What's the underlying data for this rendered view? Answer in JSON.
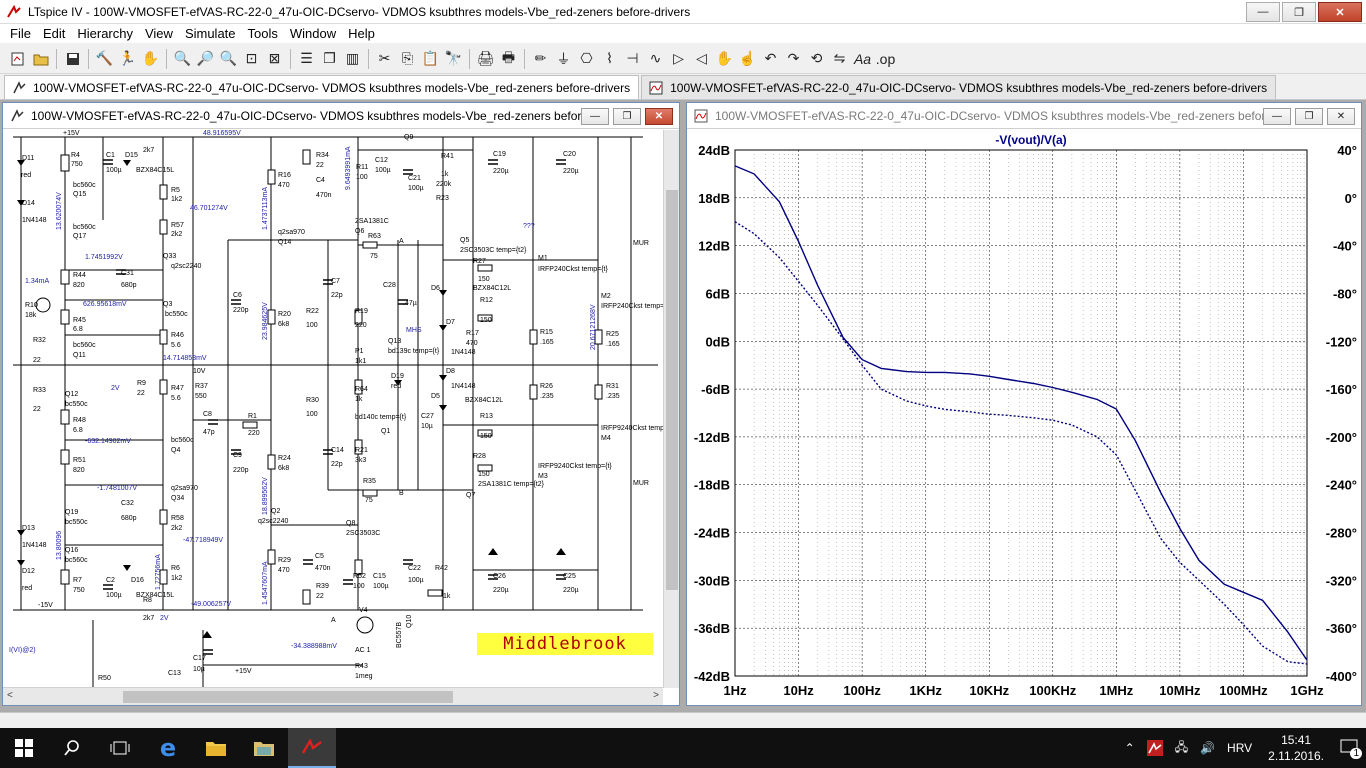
{
  "window": {
    "title": "LTspice IV - 100W-VMOSFET-efVAS-RC-22-0_47u-OIC-DCservo- VDMOS ksubthres models-Vbe_red-zeners before-drivers",
    "minimize": "—",
    "restore": "❐",
    "close": "✕"
  },
  "menu": [
    "File",
    "Edit",
    "Hierarchy",
    "View",
    "Simulate",
    "Tools",
    "Window",
    "Help"
  ],
  "tabs": [
    {
      "label": "100W-VMOSFET-efVAS-RC-22-0_47u-OIC-DCservo- VDMOS ksubthres models-Vbe_red-zeners before-drivers",
      "icon": "schematic-icon"
    },
    {
      "label": "100W-VMOSFET-efVAS-RC-22-0_47u-OIC-DCservo- VDMOS ksubthres models-Vbe_red-zeners before-drivers",
      "icon": "waveform-icon"
    }
  ],
  "schematic_window": {
    "title": "100W-VMOSFET-efVAS-RC-22-0_47u-OIC-DCservo- VDMOS ksubthres models-Vbe_red-zeners before-drivers",
    "banner": "Middlebrook",
    "labels": {
      "d11": "D11",
      "red": "red",
      "r4": "R4",
      "v750": "750",
      "c1": "C1",
      "u100": "100µ",
      "d15": "D15",
      "r2k7": "2k7",
      "bzx": "BZX84C15L",
      "bc560c": "bc560c",
      "q15": "Q15",
      "d14": "D14",
      "n1n4148": "1N4148",
      "q17": "Q17",
      "r10": "R10",
      "k18": "18k",
      "r32": "R32",
      "v22": "22",
      "r33": "R33",
      "q12": "Q12",
      "bc550c": "bc550c",
      "q11": "Q11",
      "r44": "R44",
      "v820": "820",
      "r45": "R45",
      "v6_8": "6.8",
      "c31": "C31",
      "p680": "680p",
      "q33": "Q33",
      "q2sc2240": "q2sc2240",
      "q3": "Q3",
      "r5": "R5",
      "k1k2": "1k2",
      "r57": "R57",
      "k2k2": "2k2",
      "r46": "R46",
      "v5_6": "5.6",
      "r47": "R47",
      "r37": "R37",
      "v550": "550",
      "r9": "R9",
      "v2v": "2V",
      "v10v": "10V",
      "r48": "R48",
      "q4": "Q4",
      "bc560": "bc560c",
      "r51": "R51",
      "q19": "Q19",
      "q16": "Q16",
      "d13": "D13",
      "d12": "D12",
      "r7": "R7",
      "c2": "C2",
      "d16": "D16",
      "r8": "R8",
      "r6": "R6",
      "c32": "C32",
      "q34": "Q34",
      "q2sa970": "q2sa970",
      "r58": "R58",
      "m15v": "-15V",
      "p15v": "+15V",
      "c6": "C6",
      "p220": "220p",
      "c8": "C8",
      "p47": "47p",
      "r1": "R1",
      "v220": "220",
      "c9": "C9",
      "r16": "R16",
      "v470": "470",
      "q14": "Q14",
      "r20": "R20",
      "k6k8": "6k8",
      "r24": "R24",
      "q2": "Q2",
      "r29": "R29",
      "r34": "R34",
      "c4": "C4",
      "n470": "470n",
      "c12": "C12",
      "v100": "100",
      "q9": "Q9",
      "r41": "R41",
      "k1k": "1k",
      "c21": "C21",
      "k220": "220k",
      "r23": "R23",
      "c19": "C19",
      "u220": "220µ",
      "c20": "C20",
      "q6": "Q6",
      "sa1381": "2SA1381C",
      "r63": "R63",
      "v75": "75",
      "c7": "C7",
      "p22": "22p",
      "r22": "R22",
      "r19": "R19",
      "c28": "C28",
      "u47": ".47µ",
      "r30": "R30",
      "p1": "P1",
      "k1k1": "1k1",
      "q13": "Q13",
      "bd139": "bd139c temp={t}",
      "d19": "D19",
      "r64": "R64",
      "bd140": "bd140c temp={t}",
      "q1": "Q1",
      "c27": "C27",
      "u10": "10µ",
      "c14": "C14",
      "r21": "R21",
      "k3k3": "3k3",
      "r35": "R35",
      "q8": "Q8",
      "sc3503": "2SC3503C",
      "c5": "C5",
      "r39": "R39",
      "r52": "R52",
      "c15": "C15",
      "c22": "C22",
      "r42": "R42",
      "c26": "C26",
      "c25": "C25",
      "v4": "V4",
      "bc557b": "BC557B",
      "q10": "Q10",
      "q5": "Q5",
      "sc3503t": "2SC3503C temp={t2}",
      "m1": "M1",
      "irfp240": "IRFP240Ckst temp={t}",
      "r27": "R27",
      "v150": "150",
      "bzx12": "BZX84C12L",
      "r12": "R12",
      "d6": "D6",
      "d7": "D7",
      "r17": "R17",
      "r15": "R15",
      "v165": ".165",
      "m2": "M2",
      "r25": "R25",
      "d8": "D8",
      "d5": "D5",
      "r26": "R26",
      "v235": ".235",
      "r31": "R31",
      "r13": "R13",
      "m4": "M4",
      "irfp9240": "IRFP9240Ckst temp={t}",
      "r28": "R28",
      "m3": "M3",
      "q7": "Q7",
      "sa1381t": "2SA1381C temp={t2}",
      "mur": "MUR",
      "mhs": "MHS",
      "qqq": "???",
      "c17": "C17",
      "u10b": "10µ",
      "c13": "C13",
      "r50": "R50",
      "r43": "R43",
      "meg": "1meg",
      "ac1": "AC 1",
      "a": "A",
      "b": "B",
      "vvi": "I(VI)@2)",
      "k1k34": "1.34mA",
      "r11": "R11"
    },
    "node_voltages": {
      "n1": "48.916595V",
      "n2": "46.701274V",
      "n3": "13.620074V",
      "n4": "1.7451992V",
      "n5": "626.95618mV",
      "n6": "14.714853mV",
      "n7": "-632.14902mV",
      "n8": "-1.7481007V",
      "n9": "-47.718949V",
      "n10": "-49.006257V",
      "n11": "-34.388988mV",
      "n12": "1.4737113mA",
      "n13": "23.984625V",
      "n14": "18.899562V",
      "n15": "1.4547607mA",
      "n16": "9.6493991mA",
      "n17": "20.67121268V",
      "n18": "13.80096",
      "n19": "1.72756mA",
      "n20": "1.7451992V"
    }
  },
  "plot_window": {
    "title": "100W-VMOSFET-efVAS-RC-22-0_47u-OIC-DCservo- VDMOS ksubthres models-Vbe_red-zeners before-drivers"
  },
  "chart_data": {
    "type": "line",
    "title": "-V(vout)/V(a)",
    "x_scale": "log",
    "xlim": [
      1,
      1000000000
    ],
    "x_ticks": [
      "1Hz",
      "10Hz",
      "100Hz",
      "1KHz",
      "10KHz",
      "100KHz",
      "1MHz",
      "10MHz",
      "100MHz",
      "1GHz"
    ],
    "ylim_left": [
      -42,
      24
    ],
    "y_ticks_left": [
      "24dB",
      "18dB",
      "12dB",
      "6dB",
      "0dB",
      "-6dB",
      "-12dB",
      "-18dB",
      "-24dB",
      "-30dB",
      "-36dB",
      "-42dB"
    ],
    "ylim_right": [
      -400,
      40
    ],
    "y_ticks_right": [
      "40°",
      "0°",
      "-40°",
      "-80°",
      "-120°",
      "-160°",
      "-200°",
      "-240°",
      "-280°",
      "-320°",
      "-360°",
      "-400°"
    ],
    "grid": true,
    "series": [
      {
        "style": "solid",
        "axis": "left",
        "color": "#000080",
        "x": [
          1,
          2,
          5,
          10,
          20,
          50,
          100,
          200,
          500,
          1000,
          2000,
          5000,
          10000,
          20000,
          50000,
          100000,
          200000,
          500000,
          1000000,
          2000000,
          5000000,
          10000000,
          20000000,
          50000000,
          100000000,
          200000000,
          500000000,
          1000000000
        ],
        "y": [
          22,
          21,
          17.5,
          12.5,
          7,
          0.5,
          -2.3,
          -3.4,
          -3.8,
          -3.9,
          -3.9,
          -4.1,
          -4.4,
          -4.8,
          -5.3,
          -5.8,
          -6.4,
          -7.3,
          -8.5,
          -12.5,
          -19,
          -23.5,
          -27.5,
          -30.5,
          -31.5,
          -32.5,
          -36.5,
          -40
        ]
      },
      {
        "style": "dotted",
        "axis": "right",
        "color": "#000080",
        "x": [
          1,
          2,
          5,
          10,
          20,
          50,
          100,
          200,
          500,
          1000,
          2000,
          5000,
          10000,
          20000,
          50000,
          100000,
          200000,
          500000,
          1000000,
          2000000,
          5000000,
          10000000,
          20000000,
          50000000,
          100000000,
          200000000,
          500000000,
          1000000000
        ],
        "y": [
          -20,
          -30,
          -50,
          -70,
          -90,
          -118,
          -140,
          -160,
          -170,
          -174,
          -177,
          -179,
          -181,
          -182,
          -184,
          -186,
          -190,
          -200,
          -215,
          -245,
          -285,
          -305,
          -320,
          -340,
          -357,
          -375,
          -388,
          -390
        ]
      }
    ]
  },
  "taskbar": {
    "items": [
      "start-icon",
      "search-icon",
      "task-view-icon",
      "edge-icon",
      "explorer-icon",
      "folder-icon",
      "ltspice-icon"
    ],
    "tray_lang": "HRV",
    "time": "15:41",
    "date": "2.11.2016.",
    "notification_count": "1"
  }
}
